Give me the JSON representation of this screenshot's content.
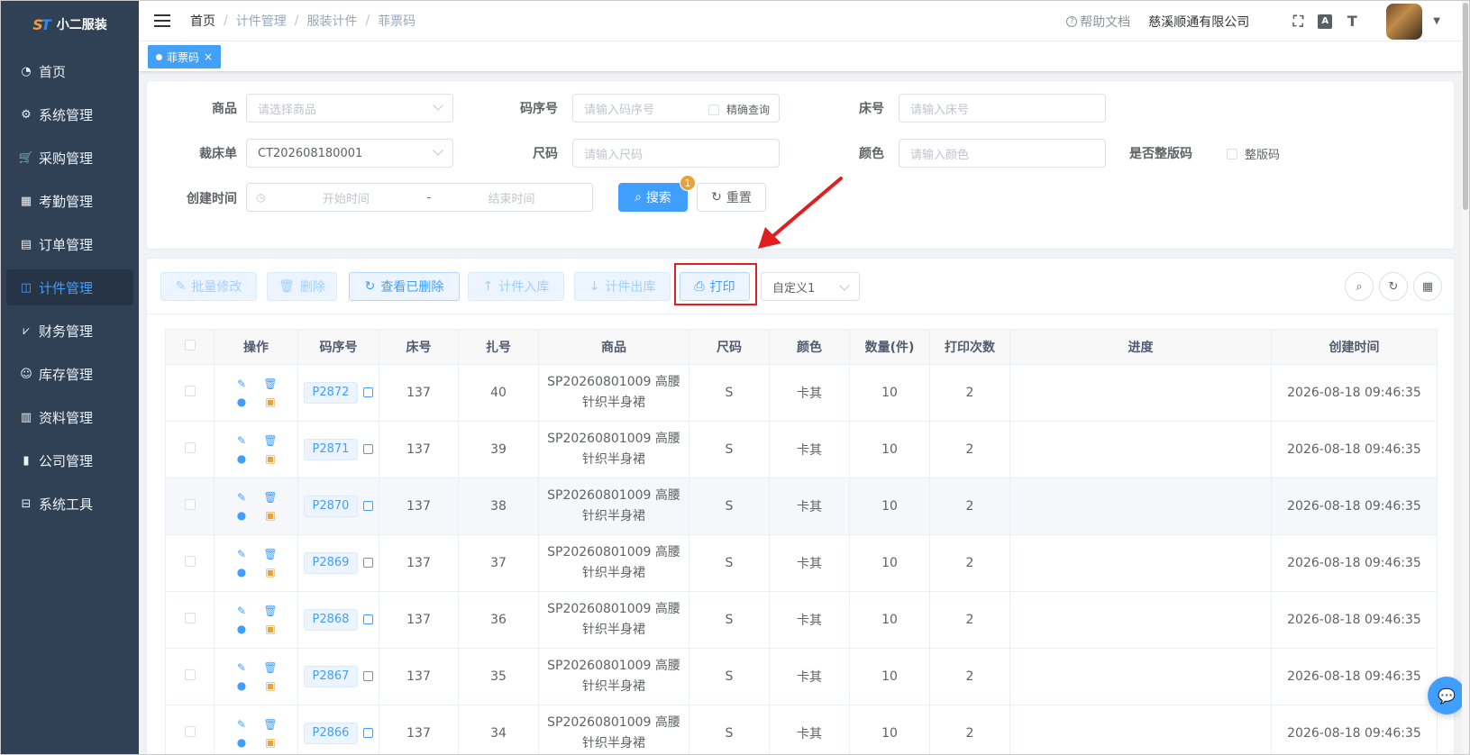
{
  "app": {
    "title": "小二服装"
  },
  "sidebar": {
    "items": [
      {
        "label": "首页",
        "icon": "dashboard-icon"
      },
      {
        "label": "系统管理",
        "icon": "gear-icon"
      },
      {
        "label": "采购管理",
        "icon": "cart-icon"
      },
      {
        "label": "考勤管理",
        "icon": "grid-icon"
      },
      {
        "label": "订单管理",
        "icon": "order-icon"
      },
      {
        "label": "计件管理",
        "icon": "book-icon",
        "active": true
      },
      {
        "label": "财务管理",
        "icon": "chart-icon"
      },
      {
        "label": "库存管理",
        "icon": "user-icon"
      },
      {
        "label": "资料管理",
        "icon": "document-icon"
      },
      {
        "label": "公司管理",
        "icon": "bar-chart-icon"
      },
      {
        "label": "系统工具",
        "icon": "toolbox-icon"
      }
    ]
  },
  "header": {
    "breadcrumb": [
      "首页",
      "计件管理",
      "服装计件",
      "菲票码"
    ],
    "help_label": "帮助文档",
    "company": "慈溪顺通有限公司"
  },
  "tags": {
    "active_tag": "菲票码"
  },
  "search": {
    "product_label": "商品",
    "product_placeholder": "请选择商品",
    "code_label": "码序号",
    "code_placeholder": "请输入码序号",
    "exact_label": "精确查询",
    "bed_label": "床号",
    "bed_placeholder": "请输入床号",
    "cut_label": "裁床单",
    "cut_value": "CT202608180001",
    "size_label": "尺码",
    "size_placeholder": "请输入尺码",
    "color_label": "颜色",
    "color_placeholder": "请输入颜色",
    "full_label": "是否整版码",
    "full_check_label": "整版码",
    "time_label": "创建时间",
    "start_placeholder": "开始时间",
    "end_placeholder": "结束时间",
    "range_sep": "-",
    "search_btn": "搜索",
    "search_badge": "1",
    "reset_btn": "重置"
  },
  "toolbar": {
    "batch_edit": "批量修改",
    "delete": "删除",
    "view_deleted": "查看已删除",
    "stock_in": "计件入库",
    "stock_out": "计件出库",
    "print": "打印",
    "custom_select": "自定义1"
  },
  "table": {
    "headers": [
      "操作",
      "码序号",
      "床号",
      "扎号",
      "商品",
      "尺码",
      "颜色",
      "数量(件)",
      "打印次数",
      "进度",
      "创建时间"
    ],
    "rows": [
      {
        "code": "P2872",
        "bed": "137",
        "bundle": "40",
        "product1": "SP20260801009 高腰",
        "product2": "针织半身裙",
        "size": "S",
        "color": "卡其",
        "qty": "10",
        "prints": "2",
        "progress": "",
        "created": "2026-08-18 09:46:35"
      },
      {
        "code": "P2871",
        "bed": "137",
        "bundle": "39",
        "product1": "SP20260801009 高腰",
        "product2": "针织半身裙",
        "size": "S",
        "color": "卡其",
        "qty": "10",
        "prints": "2",
        "progress": "",
        "created": "2026-08-18 09:46:35"
      },
      {
        "code": "P2870",
        "bed": "137",
        "bundle": "38",
        "product1": "SP20260801009 高腰",
        "product2": "针织半身裙",
        "size": "S",
        "color": "卡其",
        "qty": "10",
        "prints": "2",
        "progress": "",
        "created": "2026-08-18 09:46:35"
      },
      {
        "code": "P2869",
        "bed": "137",
        "bundle": "37",
        "product1": "SP20260801009 高腰",
        "product2": "针织半身裙",
        "size": "S",
        "color": "卡其",
        "qty": "10",
        "prints": "2",
        "progress": "",
        "created": "2026-08-18 09:46:35"
      },
      {
        "code": "P2868",
        "bed": "137",
        "bundle": "36",
        "product1": "SP20260801009 高腰",
        "product2": "针织半身裙",
        "size": "S",
        "color": "卡其",
        "qty": "10",
        "prints": "2",
        "progress": "",
        "created": "2026-08-18 09:46:35"
      },
      {
        "code": "P2867",
        "bed": "137",
        "bundle": "35",
        "product1": "SP20260801009 高腰",
        "product2": "针织半身裙",
        "size": "S",
        "color": "卡其",
        "qty": "10",
        "prints": "2",
        "progress": "",
        "created": "2026-08-18 09:46:35"
      },
      {
        "code": "P2866",
        "bed": "137",
        "bundle": "34",
        "product1": "SP20260801009 高腰",
        "product2": "针织半身裙",
        "size": "S",
        "color": "卡其",
        "qty": "10",
        "prints": "2",
        "progress": "",
        "created": "2026-08-18 09:46:35"
      }
    ]
  },
  "colors": {
    "primary": "#409eff",
    "sidebar_bg": "#304156",
    "annotation": "#e02020",
    "badge": "#e6a23c"
  }
}
